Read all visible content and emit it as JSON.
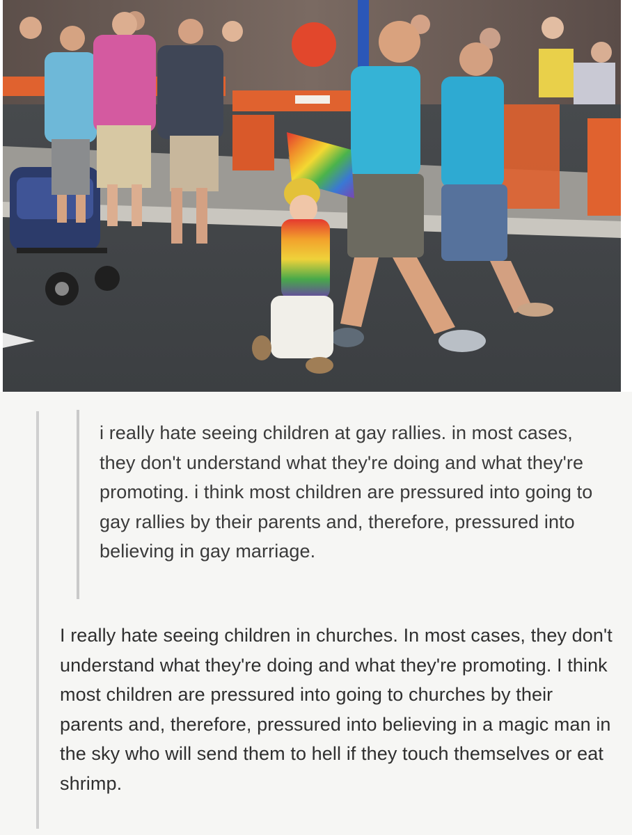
{
  "photo": {
    "balloon_text": "",
    "colors": {
      "asphalt": "#45484b",
      "crowd": "#6b5a55",
      "barrier": "#e0622f",
      "shirt_blue": "#35b3d6",
      "shirt_pink": "#d45aa0",
      "rainbow": [
        "#e2362f",
        "#f08c2a",
        "#f3d832",
        "#4bb34b",
        "#3a78d4",
        "#7a45b0"
      ]
    }
  },
  "post": {
    "quote_paragraph": "i really hate seeing children at gay rallies. in most cases, they don't understand what they're doing and what they're promoting. i think most children are pressured into going to gay rallies by their parents and, therefore, pressured into believing in gay marriage.",
    "reply_paragraph": "I really hate seeing children in churches.  In most cases, they don't understand what they're doing and what they're promoting.  I think most children are pressured into going to churches by their parents and, therefore, pressured into believing in a magic man in the sky who will send them to hell if they touch themselves or eat shrimp."
  }
}
